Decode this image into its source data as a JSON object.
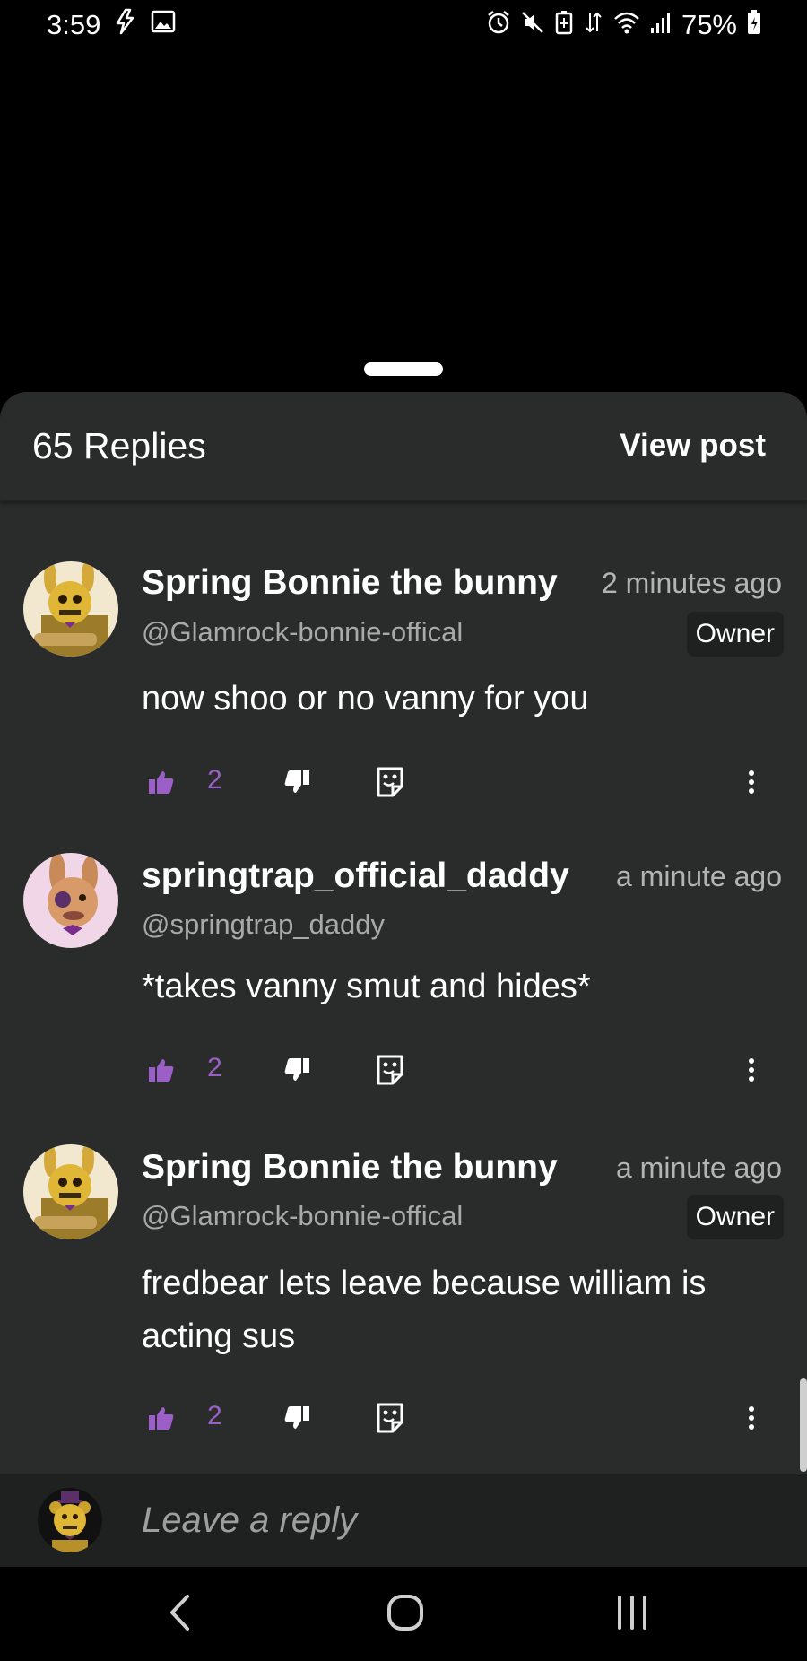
{
  "status_bar": {
    "time": "3:59",
    "battery_percent": "75%",
    "icons": [
      "flash-icon",
      "image-icon",
      "alarm-icon",
      "mute-icon",
      "battery-saver-icon",
      "data-icon",
      "wifi-icon",
      "signal-icon",
      "battery-icon"
    ]
  },
  "sheet": {
    "replies_count": "65 Replies",
    "view_post_label": "View post"
  },
  "replies": [
    {
      "author": "Spring Bonnie the bunny",
      "time": "2 minutes ago",
      "handle": "@Glamrock-bonnie-offical",
      "badge": "Owner",
      "text": "now shoo or no vanny for you",
      "likes": "2",
      "avatar": "spring-bonnie-avatar"
    },
    {
      "author": "springtrap_official_daddy",
      "time": "a minute ago",
      "handle": "@springtrap_daddy",
      "badge": "",
      "text": "*takes vanny smut and hides*",
      "likes": "2",
      "avatar": "springtrap-avatar"
    },
    {
      "author": "Spring Bonnie the bunny",
      "time": "a minute ago",
      "handle": "@Glamrock-bonnie-offical",
      "badge": "Owner",
      "text": "fredbear lets leave because william is acting sus",
      "likes": "2",
      "avatar": "spring-bonnie-avatar"
    }
  ],
  "composer": {
    "placeholder": "Leave a reply",
    "avatar": "fredbear-avatar"
  },
  "colors": {
    "sheet_bg": "#292c2b",
    "accent_purple": "#9c5fc7",
    "composer_bg": "#1f2120"
  }
}
